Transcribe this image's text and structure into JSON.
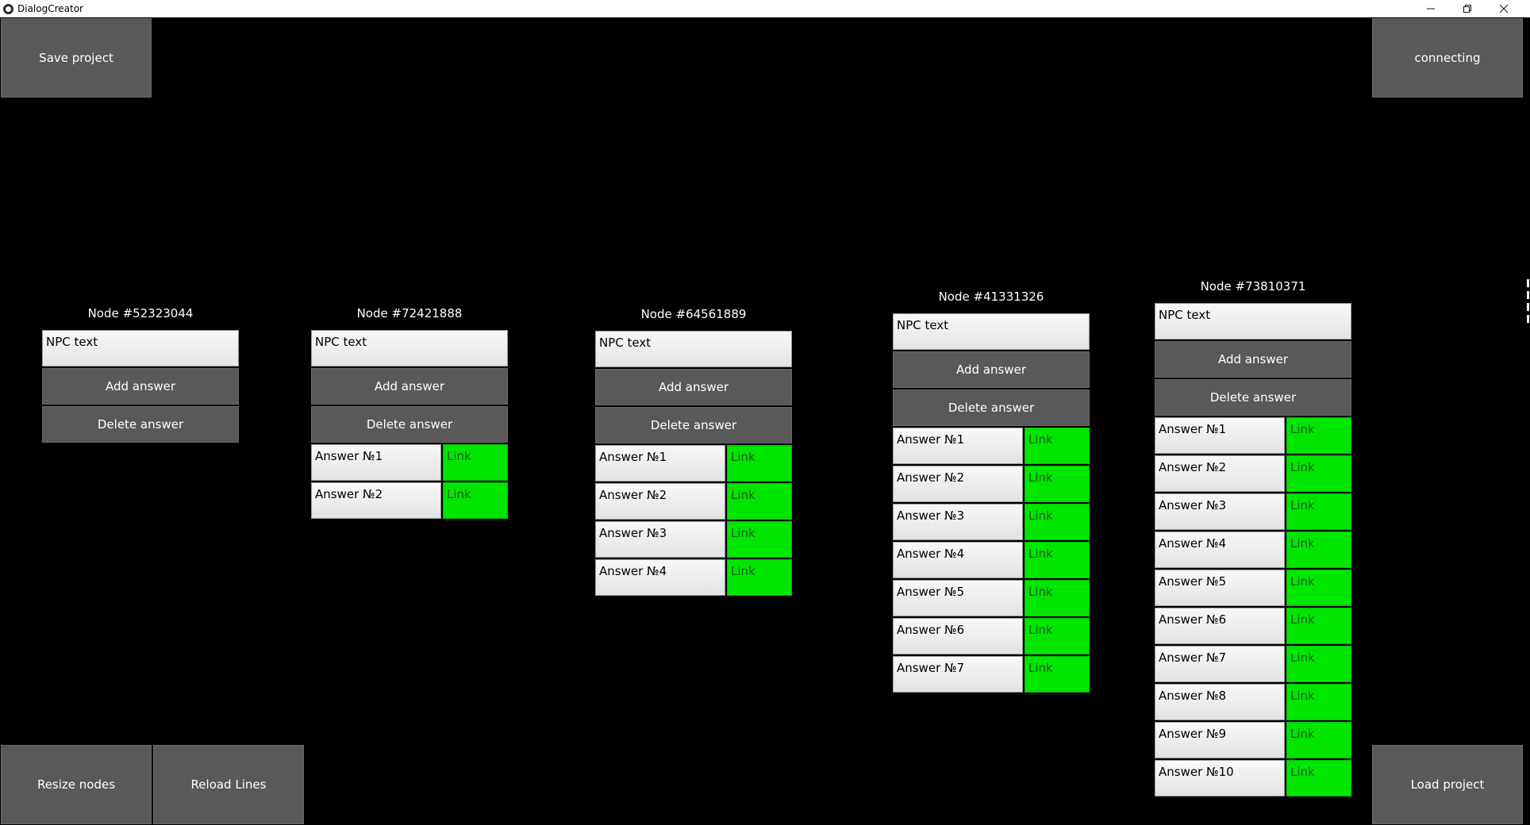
{
  "window": {
    "title": "DialogCreator",
    "minimize_label": "–",
    "restore_label": "❐",
    "close_label": "✕"
  },
  "buttons": {
    "save_project": "Save project",
    "connecting": "connecting",
    "resize_nodes": "Resize nodes",
    "reload_lines": "Reload Lines",
    "load_project": "Load project"
  },
  "nodes": [
    {
      "title": "Node #52323044",
      "npc_text": "NPC text",
      "add_answer": "Add answer",
      "delete_answer": "Delete answer",
      "answers": []
    },
    {
      "title": "Node #72421888",
      "npc_text": "NPC text",
      "add_answer": "Add answer",
      "delete_answer": "Delete answer",
      "answers": [
        {
          "label": "Answer №1",
          "link": "Link"
        },
        {
          "label": "Answer №2",
          "link": "Link"
        }
      ]
    },
    {
      "title": "Node #64561889",
      "npc_text": "NPC text",
      "add_answer": "Add answer",
      "delete_answer": "Delete answer",
      "answers": [
        {
          "label": "Answer №1",
          "link": "Link"
        },
        {
          "label": "Answer №2",
          "link": "Link"
        },
        {
          "label": "Answer №3",
          "link": "Link"
        },
        {
          "label": "Answer №4",
          "link": "Link"
        }
      ]
    },
    {
      "title": "Node #41331326",
      "npc_text": "NPC text",
      "add_answer": "Add answer",
      "delete_answer": "Delete answer",
      "answers": [
        {
          "label": "Answer №1",
          "link": "Link"
        },
        {
          "label": "Answer №2",
          "link": "Link"
        },
        {
          "label": "Answer №3",
          "link": "Link"
        },
        {
          "label": "Answer №4",
          "link": "Link"
        },
        {
          "label": "Answer №5",
          "link": "Link"
        },
        {
          "label": "Answer №6",
          "link": "Link"
        },
        {
          "label": "Answer №7",
          "link": "Link"
        }
      ]
    },
    {
      "title": "Node #73810371",
      "npc_text": "NPC text",
      "add_answer": "Add answer",
      "delete_answer": "Delete answer",
      "answers": [
        {
          "label": "Answer №1",
          "link": "Link"
        },
        {
          "label": "Answer №2",
          "link": "Link"
        },
        {
          "label": "Answer №3",
          "link": "Link"
        },
        {
          "label": "Answer №4",
          "link": "Link"
        },
        {
          "label": "Answer №5",
          "link": "Link"
        },
        {
          "label": "Answer №6",
          "link": "Link"
        },
        {
          "label": "Answer №7",
          "link": "Link"
        },
        {
          "label": "Answer №8",
          "link": "Link"
        },
        {
          "label": "Answer №9",
          "link": "Link"
        },
        {
          "label": "Answer №10",
          "link": "Link"
        }
      ]
    }
  ],
  "colors": {
    "background": "#000000",
    "button": "#595959",
    "link": "#00e600"
  }
}
